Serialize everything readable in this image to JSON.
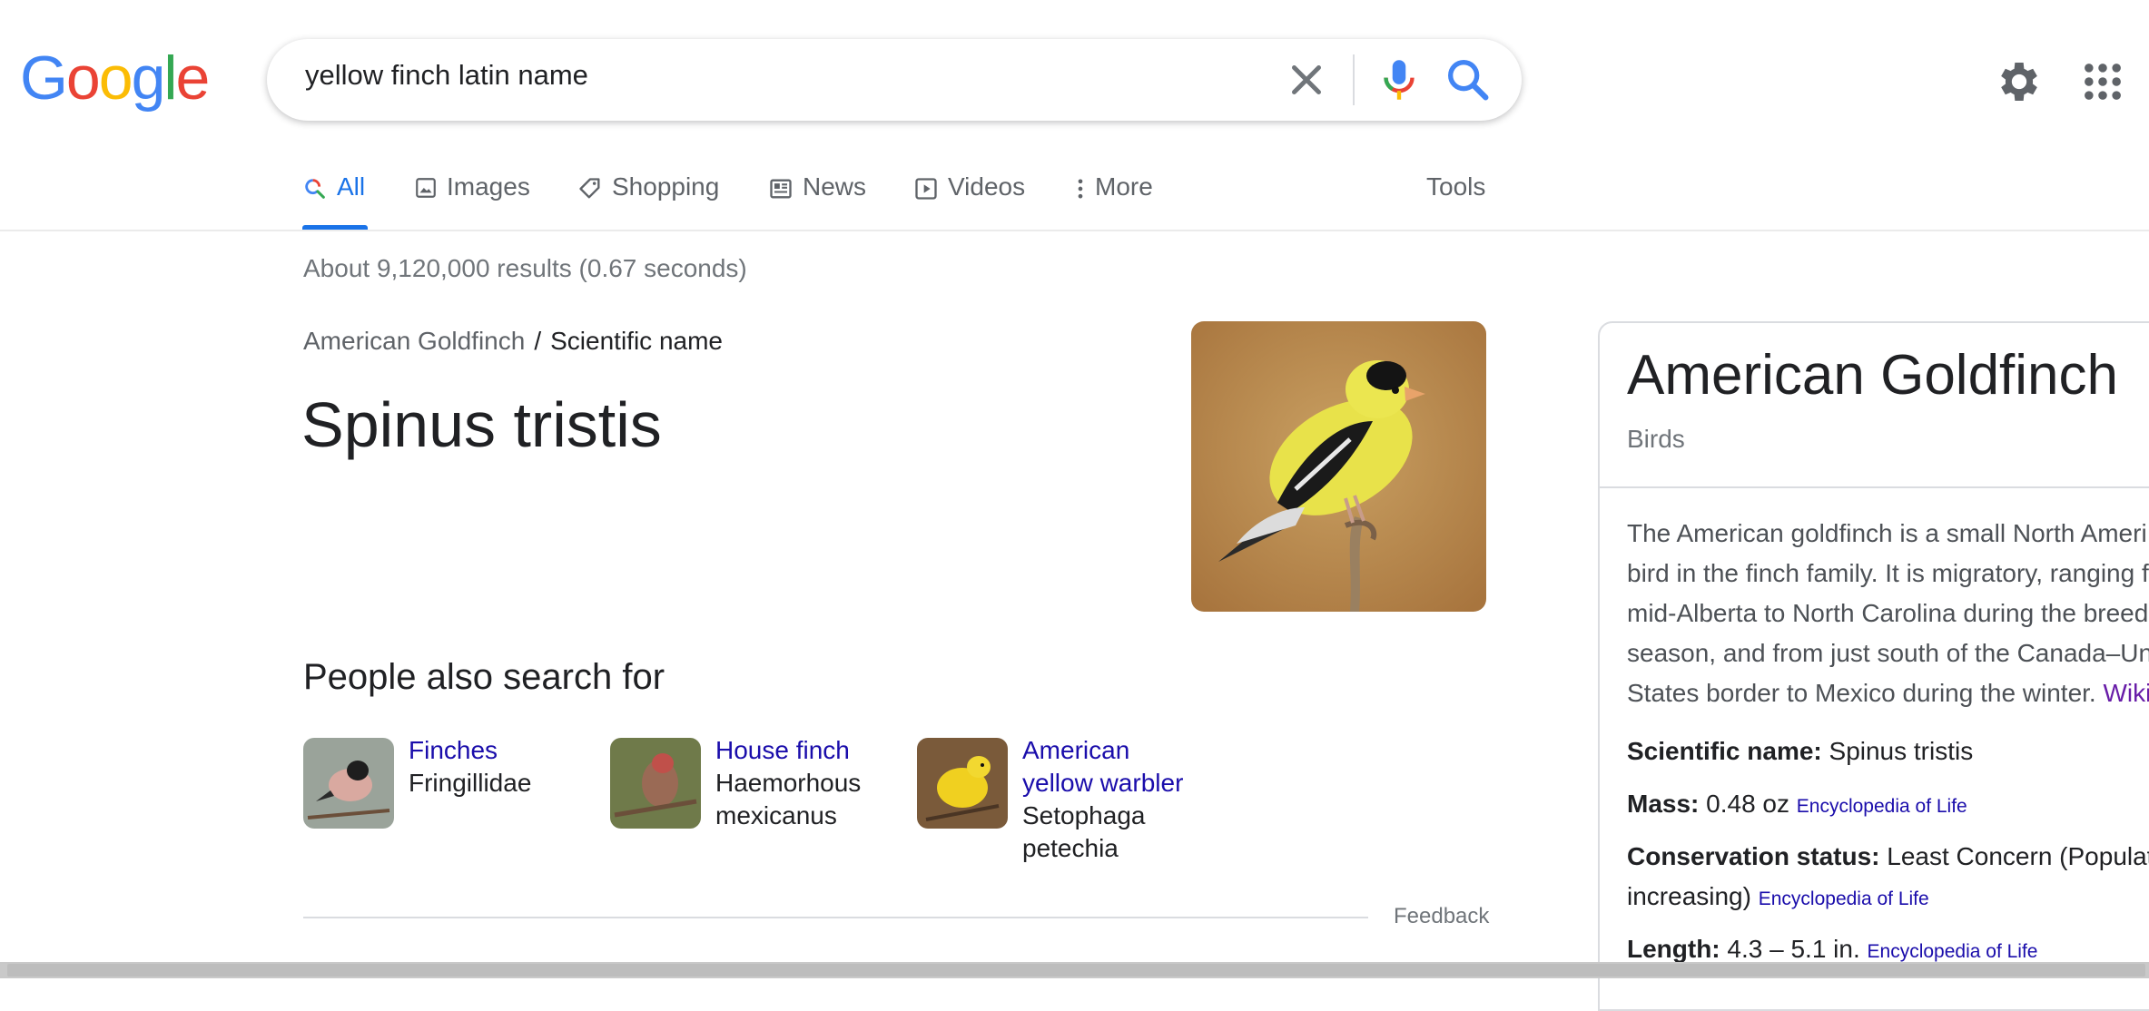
{
  "logo": {
    "text": "Google",
    "letters": [
      "G",
      "o",
      "o",
      "g",
      "l",
      "e"
    ],
    "colors": [
      "#4285f4",
      "#ea4335",
      "#fbbc05",
      "#4285f4",
      "#34a853",
      "#ea4335"
    ]
  },
  "search": {
    "query": "yellow finch latin name"
  },
  "icons": {
    "clear": "close-icon",
    "mic": "microphone-icon",
    "search": "search-icon",
    "settings": "gear-icon",
    "apps": "apps-grid-icon"
  },
  "tabs": [
    {
      "label": "All",
      "icon": "search-icon",
      "active": true
    },
    {
      "label": "Images",
      "icon": "image-icon"
    },
    {
      "label": "Shopping",
      "icon": "tag-icon"
    },
    {
      "label": "News",
      "icon": "newspaper-icon"
    },
    {
      "label": "Videos",
      "icon": "play-icon"
    },
    {
      "label": "More",
      "icon": "more-vertical-icon"
    }
  ],
  "tools_label": "Tools",
  "result_stats": "About 9,120,000 results (0.67 seconds)",
  "answer": {
    "breadcrumb_parent": "American Goldfinch",
    "breadcrumb_sep": "/",
    "breadcrumb_current": "Scientific name",
    "title": "Spinus tristis",
    "image": "american-goldfinch-photo"
  },
  "people_also_search": {
    "heading": "People also search for",
    "items": [
      {
        "name": "Finches",
        "sub1": "Fringillidae",
        "sub2": ""
      },
      {
        "name": "House finch",
        "sub1": "Haemorhous",
        "sub2": "mexicanus"
      },
      {
        "name_line1": "American",
        "name_line2": "yellow warbler",
        "sub1": "Setophaga",
        "sub2": "petechia"
      }
    ]
  },
  "feedback_label": "Feedback",
  "knowledge_panel": {
    "title": "American Goldfinch",
    "subtitle": "Birds",
    "description": "The American goldfinch is a small North Ameri\nbird in the finch family. It is migratory, ranging f\nmid-Alberta to North Carolina during the breed\nseason, and from just south of the Canada–Un\nStates border to Mexico during the winter. ",
    "wiki_link": "Wiki",
    "facts": {
      "sci_label": "Scientific name:",
      "sci_value": " Spinus tristis",
      "mass_label": "Mass:",
      "mass_value": " 0.48 oz ",
      "mass_src": "Encyclopedia of Life",
      "cons_label": "Conservation status:",
      "cons_value": " Least Concern (Populatio",
      "cons_value2": "increasing) ",
      "cons_src": "Encyclopedia of Life",
      "len_label": "Length:",
      "len_value": " 4.3 – 5.1 in. ",
      "len_src": "Encyclopedia of Life"
    }
  }
}
